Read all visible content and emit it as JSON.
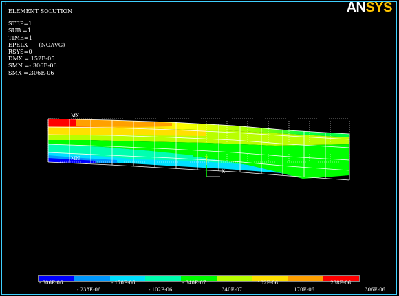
{
  "window": {
    "number": "1"
  },
  "title": "ELEMENT SOLUTION",
  "info_lines": [
    "STEP=1",
    "SUB =1",
    "TIME=1",
    "EPELX      (NOAVG)",
    "RSYS=0",
    "DMX =.152E-05",
    "SMN =-.306E-06",
    "SMX =.306E-06"
  ],
  "logo": {
    "part1": "AN",
    "part2": "SYS"
  },
  "markers": {
    "max": "MX",
    "min": "MN"
  },
  "triad": {
    "x": "X",
    "y": "Y"
  },
  "legend": {
    "colors": [
      "#0000ff",
      "#0099ff",
      "#00e0ff",
      "#00ffb0",
      "#00ff00",
      "#b8ff00",
      "#ffe000",
      "#ffa000",
      "#ff0000"
    ],
    "upper_labels": [
      "-.306E-06",
      "-.170E-06",
      "-.340E-07",
      ".102E-06",
      ".238E-06"
    ],
    "lower_labels": [
      "-.238E-06",
      "-.102E-06",
      ".340E-07",
      ".170E-06",
      ".306E-06"
    ]
  }
}
